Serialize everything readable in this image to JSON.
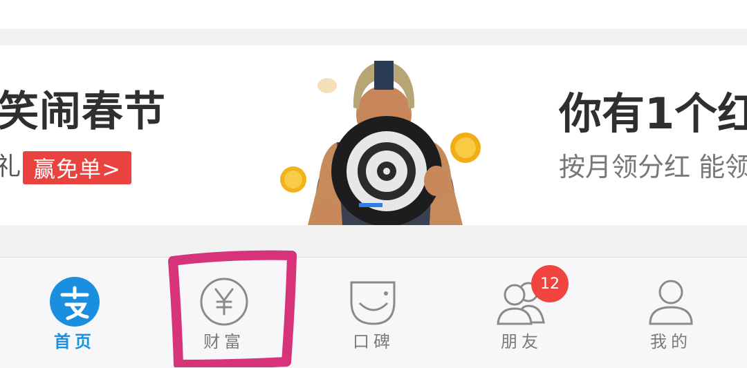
{
  "banner": {
    "left_title": "笑闹春节",
    "left_sub_fragment": "礼",
    "left_badge": "赢免单>",
    "hero_image": "man-in-helmet-holding-dartboard",
    "right_title": "你有1个红",
    "right_sub": "按月领分红 能领"
  },
  "tabbar": {
    "items": [
      {
        "label": "首页",
        "icon": "alipay-logo-icon",
        "active": true
      },
      {
        "label": "财富",
        "icon": "yen-coin-icon",
        "active": false
      },
      {
        "label": "口碑",
        "icon": "koubei-smile-icon",
        "active": false
      },
      {
        "label": "朋友",
        "icon": "friends-icon",
        "active": false
      },
      {
        "label": "我的",
        "icon": "profile-icon",
        "active": false
      }
    ],
    "friends_badge": "12",
    "active_color": "#1a8fe0",
    "badge_color": "#f0453f"
  },
  "annotation": {
    "highlight_color": "#d6337a"
  }
}
